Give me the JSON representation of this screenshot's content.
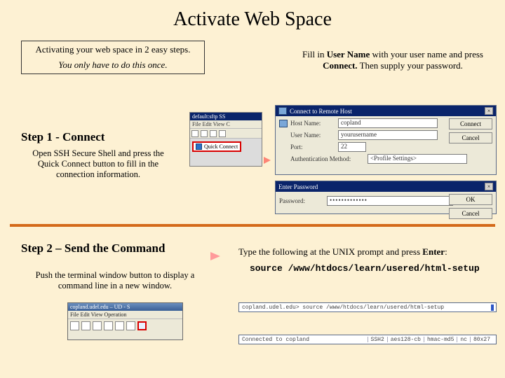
{
  "title": "Activate Web Space",
  "intro": {
    "line1": "Activating your web space in 2 easy steps.",
    "line2": "You only have to do this once."
  },
  "fill": {
    "pre": "Fill in ",
    "b1": "User Name",
    "mid": " with your user name and press ",
    "b2": "Connect.",
    "post": " Then supply your password."
  },
  "step1": {
    "head": "Step 1 - Connect",
    "body": "Open SSH Secure Shell and press the Quick Connect button to fill in the connection information."
  },
  "sftp": {
    "title": "default:sftp   SS",
    "menu": "File  Edit  View  C",
    "quick_connect": "Quick Connect"
  },
  "connect_dialog": {
    "title": "Connect to Remote Host",
    "host_label": "Host Name:",
    "host_value": "copland",
    "user_label": "User Name:",
    "user_value": "yourusername",
    "port_label": "Port:",
    "port_value": "22",
    "auth_label": "Authentication Method:",
    "auth_value": "<Profile Settings>",
    "connect_btn": "Connect",
    "cancel_btn": "Cancel",
    "close_x": "×"
  },
  "password_dialog": {
    "title": "Enter Password",
    "label": "Password:",
    "value": "•••••••••••••",
    "ok_btn": "OK",
    "cancel_btn": "Cancel",
    "close_x": "×"
  },
  "step2": {
    "head": "Step 2 – Send the Command",
    "body": "Push the terminal window button to display a command line in a new window.",
    "type_pre": "Type the following at the UNIX prompt and press ",
    "type_b": "Enter",
    "type_post": ":",
    "source_cmd": "source /www/htdocs/learn/usered/html-setup"
  },
  "mini": {
    "title": "copland.udel.edu – UD - S",
    "menu": "File  Edit  View  Operation"
  },
  "term": {
    "line1": "copland.udel.edu> source /www/htdocs/learn/usered/html-setup",
    "line2_left": "Connected to copland",
    "c1": "SSH2",
    "c2": "aes128-cb",
    "c3": "hmac-md5",
    "c4": "nc",
    "c5": "80x27"
  }
}
